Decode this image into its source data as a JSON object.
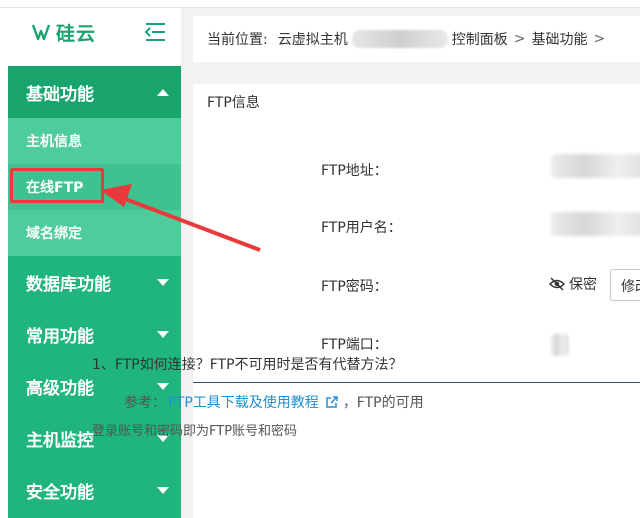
{
  "brand": {
    "name": "硅云"
  },
  "sidebar": {
    "groups": [
      {
        "label": "基础功能",
        "open": true
      },
      {
        "label": "数据库功能"
      },
      {
        "label": "常用功能"
      },
      {
        "label": "高级功能"
      },
      {
        "label": "主机监控"
      },
      {
        "label": "安全功能"
      }
    ],
    "sub_items": [
      {
        "label": "主机信息"
      },
      {
        "label": "在线FTP",
        "active": true
      },
      {
        "label": "域名绑定"
      }
    ]
  },
  "breadcrumb": {
    "prefix": "当前位置:",
    "item1": "云虚拟主机",
    "item2": "控制面板",
    "item3": "基础功能"
  },
  "panel": {
    "title": "FTP信息",
    "ftp_address_label": "FTP地址：",
    "ftp_user_label": "FTP用户名：",
    "ftp_password_label": "FTP密码：",
    "ftp_port_label": "FTP端口：",
    "password_masked": "保密",
    "edit_label": "修改",
    "faq_question": "1、FTP如何连接？FTP不可用时是否有代替方法？",
    "ref_prefix": "参考：",
    "ref_link": "FTP工具下载及使用教程",
    "ref_suffix": "，FTP的可用",
    "bottom_text": "登录账号和密码即为FTP账号和密码"
  },
  "colors": {
    "sidebar_green": "#1fb57c",
    "brand_green": "#1aa46d",
    "highlight_red": "#e83a3a",
    "link_blue": "#1f8fd6"
  }
}
